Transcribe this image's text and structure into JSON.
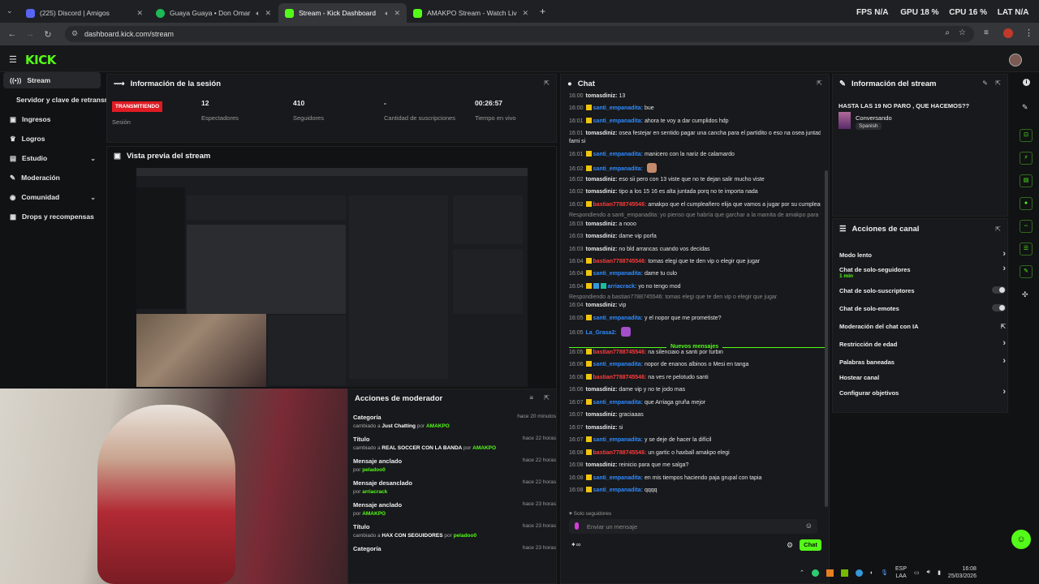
{
  "browser": {
    "tabs": [
      {
        "title": "(225) Discord | Amigos",
        "color": "#5865f2"
      },
      {
        "title": "Guaya Guaya • Don Omar",
        "color": "#1db954"
      },
      {
        "title": "Stream - Kick Dashboard",
        "color": "#53fc18"
      },
      {
        "title": "AMAKPO Stream - Watch Live o",
        "color": "#53fc18"
      }
    ],
    "url": "dashboard.kick.com/stream",
    "overlay": {
      "fps_label": "FPS",
      "fps": "N/A",
      "gpu_label": "GPU",
      "gpu": "18 %",
      "cpu_label": "CPU",
      "cpu": "16 %",
      "lat_label": "LAT",
      "lat": "N/A"
    }
  },
  "app": {
    "logo": "KICK",
    "sidebar": [
      {
        "label": "Stream",
        "icon": "broadcast-icon"
      },
      {
        "label": "Servidor y clave de retransn",
        "icon": ""
      },
      {
        "label": "Ingresos",
        "icon": "wallet-icon"
      },
      {
        "label": "Logros",
        "icon": "trophy-icon"
      },
      {
        "label": "Estudio",
        "icon": "studio-icon"
      },
      {
        "label": "Moderación",
        "icon": "wrench-icon"
      },
      {
        "label": "Comunidad",
        "icon": "community-icon"
      },
      {
        "label": "Drops y recompensas",
        "icon": "gift-icon"
      }
    ],
    "session": {
      "title": "Información de la sesión",
      "live_badge": "TRANSMITIENDO",
      "session_label": "Sesión",
      "stats": [
        {
          "value": "12",
          "label": "Espectadores"
        },
        {
          "value": "410",
          "label": "Seguidores"
        },
        {
          "value": "-",
          "label": "Cantidad de suscripciones"
        },
        {
          "value": "00:26:57",
          "label": "Tiempo en vivo"
        }
      ]
    },
    "preview": {
      "title": "Vista previa del stream"
    },
    "mod_actions": {
      "title": "Acciones de moderador",
      "rows": [
        {
          "action": "Categoría",
          "pre": "cambiado a",
          "target": "Just Chatting",
          "by": "por",
          "user": "AMAKPO",
          "time": "hace 20 minutos"
        },
        {
          "action": "Título",
          "pre": "cambiado a",
          "target": "REAL SOCCER CON LA BANDA",
          "by": "por",
          "user": "AMAKPO",
          "time": "hace 22 horas"
        },
        {
          "action": "Mensaje anclado",
          "pre": "por",
          "target": "",
          "by": "",
          "user": "peladoo0",
          "time": "hace 22 horas"
        },
        {
          "action": "Mensaje desanclado",
          "pre": "por",
          "target": "",
          "by": "",
          "user": "arriacrack",
          "time": "hace 22 horas"
        },
        {
          "action": "Mensaje anclado",
          "pre": "por",
          "target": "",
          "by": "",
          "user": "AMAKPO",
          "time": "hace 23 horas"
        },
        {
          "action": "Título",
          "pre": "cambiado a",
          "target": "HAX CON SEGUIDORES",
          "by": "por",
          "user": "peladoo0",
          "time": "hace 23 horas"
        },
        {
          "action": "Categoría",
          "pre": "",
          "target": "",
          "by": "",
          "user": "",
          "time": "hace 23 horas"
        }
      ]
    },
    "chat": {
      "title": "Chat",
      "new_messages": "Nuevos mensajes",
      "followers_only": "Solo seguidores",
      "input_placeholder": "Enviar un mensaje",
      "send_label": "Chat",
      "messages": [
        {
          "time": "16:00",
          "user": "tomasdiniz",
          "color": "#e6e6e6",
          "text": "13"
        },
        {
          "time": "16:00",
          "user": "santi_empanadita",
          "color": "#2e8bff",
          "text": "bue"
        },
        {
          "time": "16:01",
          "user": "santi_empanadita",
          "color": "#2e8bff",
          "text": "ahora te voy a dar cumplidos hdp"
        },
        {
          "time": "16:01",
          "user": "tomasdiniz",
          "color": "#e6e6e6",
          "text": "osea festejar en sentido pagar una cancha para el partidito o eso na osea juntada la"
        },
        {
          "time": "",
          "user": "",
          "color": "#e6e6e6",
          "text": "fami si"
        },
        {
          "time": "16:01",
          "user": "santi_empanadita",
          "color": "#2e8bff",
          "text": "manicero con la nariz de calamardo"
        },
        {
          "time": "16:02",
          "user": "santi_empanadita",
          "color": "#2e8bff",
          "text": ""
        },
        {
          "time": "16:02",
          "user": "tomasdiniz",
          "color": "#e6e6e6",
          "text": "eso sii pero con 13 viste que no te dejan salir mucho viste"
        },
        {
          "time": "16:02",
          "user": "tomasdiniz",
          "color": "#e6e6e6",
          "text": "tipo a los 15 16 es alta juntada porq no te importa nada"
        },
        {
          "time": "16:02",
          "user": "bastian7788745546",
          "color": "#ff3b3b",
          "text": "amakpo que el cumpleañero elija que vamos a jugar por su cumpleaños"
        },
        {
          "time": "",
          "user": "",
          "color": "#8a8a8a",
          "text": "Respondiendo a santi_empanadita: yo pienso que habría que garchar a la mamita de amakpo para festej..."
        },
        {
          "time": "16:03",
          "user": "tomasdiniz",
          "color": "#e6e6e6",
          "text": "a nooo"
        },
        {
          "time": "16:03",
          "user": "tomasdiniz",
          "color": "#e6e6e6",
          "text": "dame vip porfa"
        },
        {
          "time": "16:03",
          "user": "tomasdiniz",
          "color": "#e6e6e6",
          "text": "no bld arrancas cuando vos decidas"
        },
        {
          "time": "16:04",
          "user": "bastian7788745546",
          "color": "#ff3b3b",
          "text": "tomas elegi que te den vip o elegir que jugar"
        },
        {
          "time": "16:04",
          "user": "santi_empanadita",
          "color": "#2e8bff",
          "text": "dame tu culo"
        },
        {
          "time": "16:04",
          "user": "arriacrack",
          "color": "#2e8bff",
          "text": "yo no tengo mod"
        },
        {
          "time": "",
          "user": "",
          "color": "#8a8a8a",
          "text": "Respondiendo a bastian7788745546: tomas elegi que te den vip o elegir que jugar"
        },
        {
          "time": "16:04",
          "user": "tomasdiniz",
          "color": "#e6e6e6",
          "text": "vip"
        },
        {
          "time": "16:05",
          "user": "santi_empanadita",
          "color": "#2e8bff",
          "text": "y el nopor que me prometiste?"
        },
        {
          "time": "16:05",
          "user": "La_Grasa2",
          "color": "#2e8bff",
          "text": ""
        },
        {
          "time": "16:05",
          "user": "bastian7788745546",
          "color": "#ff3b3b",
          "text": "na silenciaio a santi por turbin"
        },
        {
          "time": "16:06",
          "user": "santi_empanadita",
          "color": "#2e8bff",
          "text": "nopor de enanos albinos o Mesi en tanga"
        },
        {
          "time": "16:06",
          "user": "bastian7788745546",
          "color": "#ff3b3b",
          "text": "na ves re pelotudo santi"
        },
        {
          "time": "16:06",
          "user": "tomasdiniz",
          "color": "#e6e6e6",
          "text": "dame vip y no te jodo mas"
        },
        {
          "time": "16:07",
          "user": "santi_empanadita",
          "color": "#2e8bff",
          "text": "que Arriaga gruña mejor"
        },
        {
          "time": "16:07",
          "user": "tomasdiniz",
          "color": "#e6e6e6",
          "text": "graciaaas"
        },
        {
          "time": "16:07",
          "user": "tomasdiniz",
          "color": "#e6e6e6",
          "text": "si"
        },
        {
          "time": "16:07",
          "user": "santi_empanadita",
          "color": "#2e8bff",
          "text": "y se deje de hacer la difícil"
        },
        {
          "time": "16:08",
          "user": "bastian7788745546",
          "color": "#ff3b3b",
          "text": "un gartic o haxball amakpo elegi"
        },
        {
          "time": "16:08",
          "user": "tomasdiniz",
          "color": "#e6e6e6",
          "text": "reinicio para que me salga?"
        },
        {
          "time": "16:08",
          "user": "santi_empanadita",
          "color": "#2e8bff",
          "text": "en mis tiempos haciendo paja grupal con tapia"
        },
        {
          "time": "16:08",
          "user": "santi_empanadita",
          "color": "#2e8bff",
          "text": "qqqq"
        }
      ]
    },
    "stream_info": {
      "title": "Información del stream",
      "stream_title": "HASTA LAS 19 NO PARO , QUE HACEMOS??",
      "category": "Conversando",
      "language": "Spanish"
    },
    "channel_actions": {
      "title": "Acciones de canal",
      "rows": [
        {
          "label": "Modo lento",
          "sub": "",
          "control": "chevron"
        },
        {
          "label": "Chat de solo-seguidores",
          "sub": "1 min",
          "control": "chevron"
        },
        {
          "label": "Chat de solo-suscriptores",
          "sub": "",
          "control": "toggle"
        },
        {
          "label": "Chat de solo-emotes",
          "sub": "",
          "control": "toggle"
        },
        {
          "label": "Moderación del chat con IA",
          "sub": "",
          "control": "external"
        },
        {
          "label": "Restricción de edad",
          "sub": "",
          "control": "chevron"
        },
        {
          "label": "Palabras baneadas",
          "sub": "",
          "control": "chevron"
        },
        {
          "label": "Hostear canal",
          "sub": "",
          "control": ""
        },
        {
          "label": "Configurar objetivos",
          "sub": "",
          "control": "chevron"
        }
      ]
    }
  },
  "taskbar": {
    "lang": "ESP",
    "layout": "LAA",
    "time": "16:08",
    "date": "25/03/2026"
  }
}
